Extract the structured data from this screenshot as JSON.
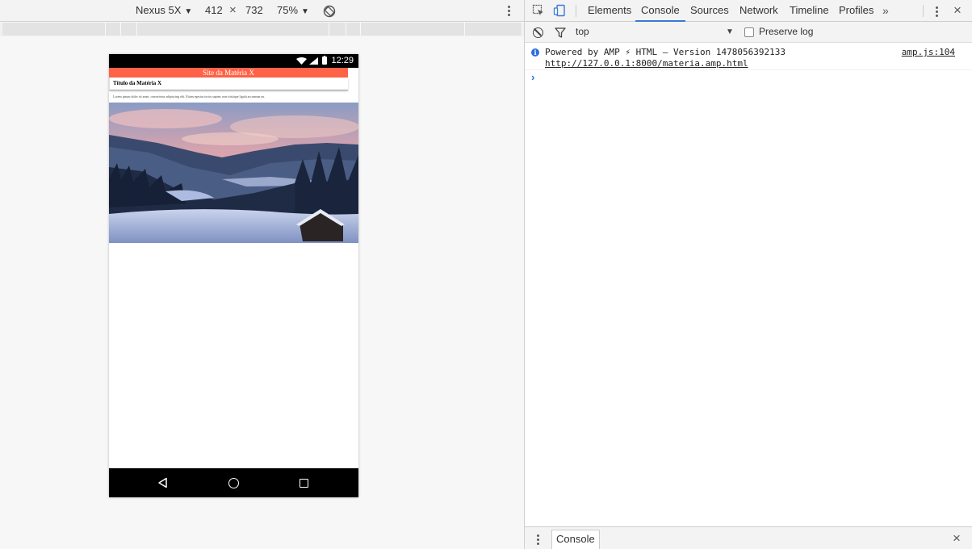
{
  "emulation": {
    "device": "Nexus 5X",
    "width": "412",
    "times": "×",
    "height": "732",
    "zoom": "75%"
  },
  "phone": {
    "status_time": "12:29",
    "site_title": "Site da Matéria X",
    "article_title": "Título da Matéria X",
    "lorem": "Lorem ipsum dolor sit amet, consectetur adipiscing elit. Etiam egestas tortor sapien, non tristique ligula accumsan eu."
  },
  "devtools": {
    "tabs": [
      "Elements",
      "Console",
      "Sources",
      "Network",
      "Timeline",
      "Profiles"
    ],
    "active_tab": "Console",
    "overflow": "»",
    "close": "×",
    "console": {
      "context": "top",
      "preserve_log": "Preserve log",
      "preserve_log_checked": false,
      "messages": [
        {
          "level": "info",
          "text": "Powered by AMP ⚡ HTML – Version 1478056392133",
          "url": "http://127.0.0.1:8000/materia.amp.html",
          "source": "amp.js:104"
        }
      ],
      "prompt": "›"
    },
    "drawer": {
      "tab": "Console",
      "close": "×"
    }
  },
  "colors": {
    "amp_header": "#ff6347",
    "active_tab_underline": "#3879d9",
    "info_blue": "#2f6edb"
  }
}
